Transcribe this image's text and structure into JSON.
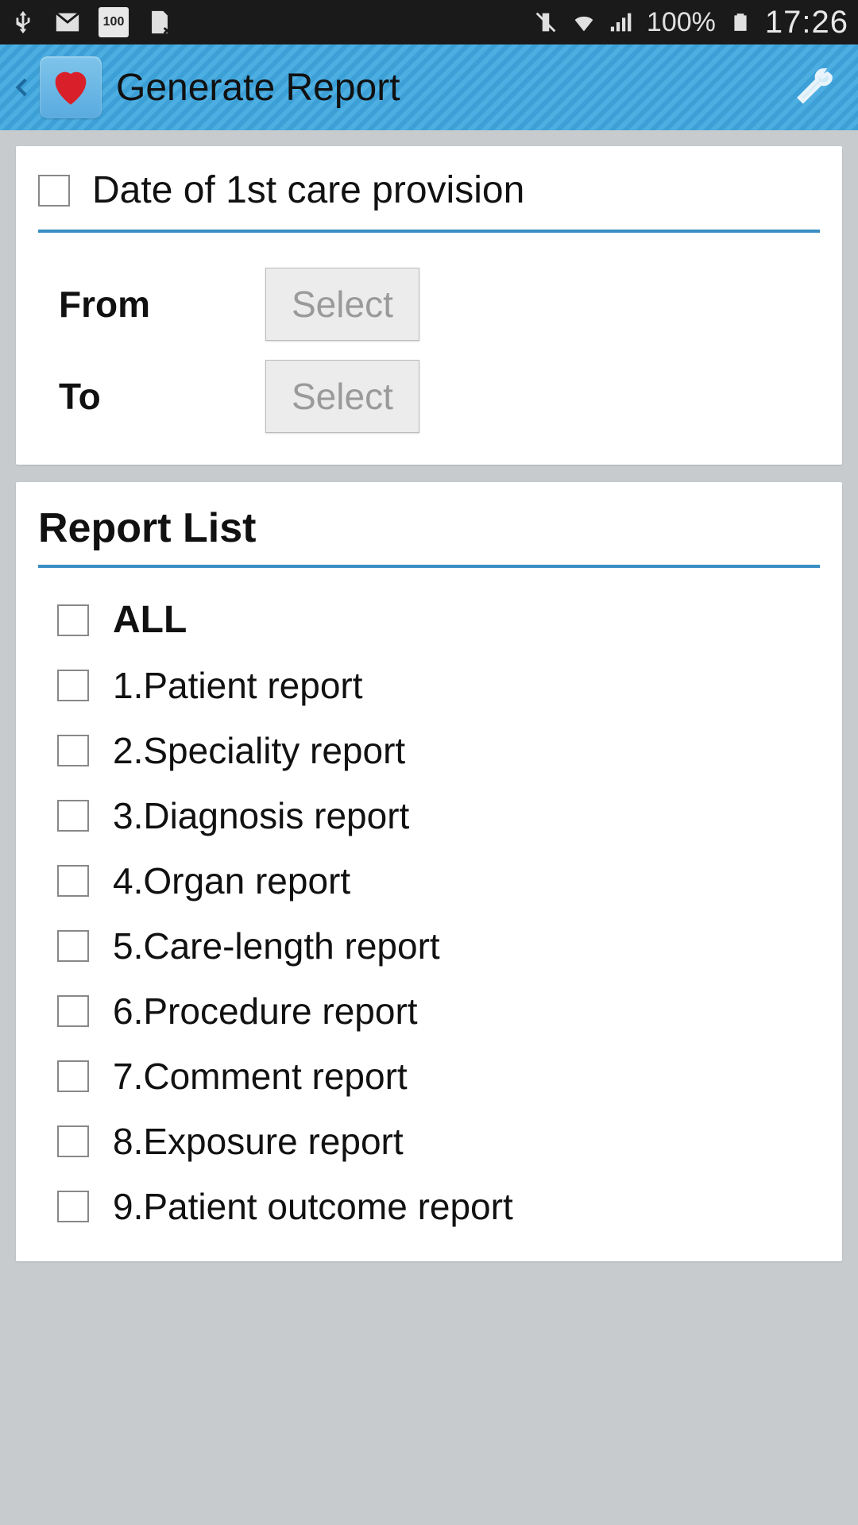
{
  "status": {
    "battery_pct": "100%",
    "time": "17:26",
    "badge_100": "100"
  },
  "appbar": {
    "title": "Generate Report"
  },
  "date_section": {
    "header": "Date of 1st care provision",
    "from_label": "From",
    "to_label": "To",
    "select_label": "Select"
  },
  "report_list": {
    "title": "Report List",
    "all_label": "ALL",
    "items": [
      {
        "label": "1.Patient report"
      },
      {
        "label": "2.Speciality report"
      },
      {
        "label": "3.Diagnosis report"
      },
      {
        "label": "4.Organ report"
      },
      {
        "label": "5.Care-length report"
      },
      {
        "label": "6.Procedure report"
      },
      {
        "label": "7.Comment report"
      },
      {
        "label": "8.Exposure report"
      },
      {
        "label": "9.Patient outcome report"
      }
    ]
  }
}
